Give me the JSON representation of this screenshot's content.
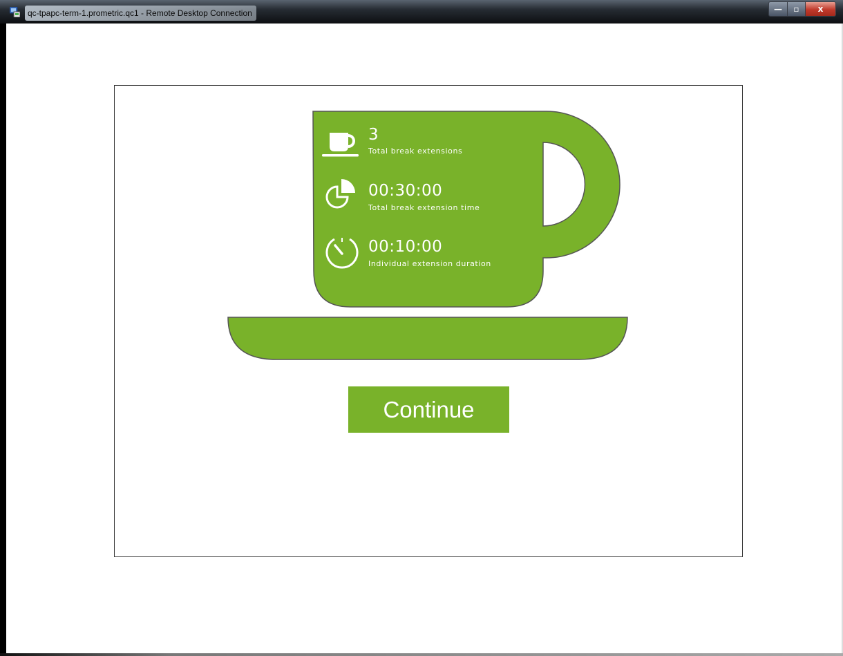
{
  "window": {
    "title": "qc-tpapc-term-1.prometric.qc1 - Remote Desktop Connection",
    "buttons": {
      "minimize": "—",
      "maximize": "▫",
      "close": "x"
    }
  },
  "colors": {
    "accent": "#79b22a",
    "outline": "#555555",
    "text": "#ffffff"
  },
  "stats": [
    {
      "icon": "coffee-cup-icon",
      "value": "3",
      "label": "Total break extensions"
    },
    {
      "icon": "pie-chart-icon",
      "value": "00:30:00",
      "label": "Total break extension time"
    },
    {
      "icon": "stopwatch-icon",
      "value": "00:10:00",
      "label": "Individual extension duration"
    }
  ],
  "actions": {
    "continue_label": "Continue"
  }
}
